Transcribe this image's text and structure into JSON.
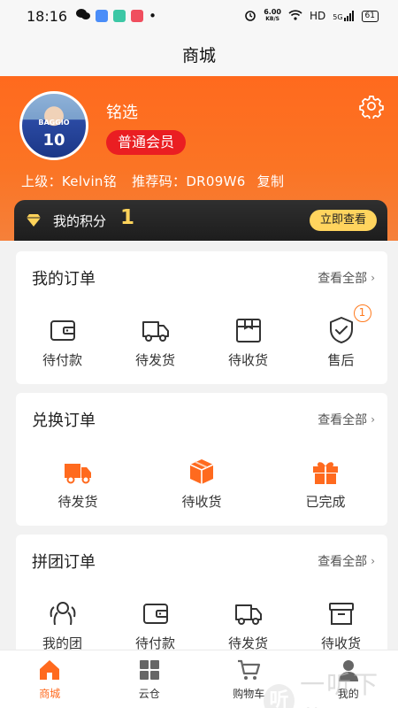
{
  "status_bar": {
    "time": "18:16",
    "dot": "•",
    "net_speed_value": "6.00",
    "net_speed_unit": "KB/S",
    "hd": "HD",
    "signal": "5G",
    "battery": "61"
  },
  "header": {
    "title": "商城"
  },
  "profile": {
    "name": "铭选",
    "member_level": "普通会员",
    "avatar_jersey_name": "BAGGIO",
    "avatar_jersey_number": "10",
    "referrer_label": "上级：",
    "referrer_name": "Kelvin铭",
    "ref_code_label": "推荐码：",
    "ref_code": "DR09W6",
    "copy_label": "复制"
  },
  "points": {
    "label": "我的积分",
    "value": "1",
    "button": "立即查看"
  },
  "my_orders": {
    "title": "我的订单",
    "view_all": "查看全部",
    "items": [
      {
        "label": "待付款",
        "icon": "wallet-icon"
      },
      {
        "label": "待发货",
        "icon": "truck-icon"
      },
      {
        "label": "待收货",
        "icon": "package-icon"
      },
      {
        "label": "售后",
        "icon": "shield-check-icon",
        "badge": "1"
      }
    ]
  },
  "exchange_orders": {
    "title": "兑换订单",
    "view_all": "查看全部",
    "items": [
      {
        "label": "待发货",
        "icon": "truck-filled-icon"
      },
      {
        "label": "待收货",
        "icon": "box-filled-icon"
      },
      {
        "label": "已完成",
        "icon": "gift-icon"
      }
    ]
  },
  "group_orders": {
    "title": "拼团订单",
    "view_all": "查看全部",
    "items": [
      {
        "label": "我的团",
        "icon": "group-icon"
      },
      {
        "label": "待付款",
        "icon": "wallet-icon"
      },
      {
        "label": "待发货",
        "icon": "truck-icon"
      },
      {
        "label": "待收货",
        "icon": "archive-box-icon"
      }
    ]
  },
  "bottom_nav": [
    {
      "label": "商城",
      "icon": "home-icon",
      "active": true
    },
    {
      "label": "云仓",
      "icon": "grid-icon"
    },
    {
      "label": "购物车",
      "icon": "cart-icon"
    },
    {
      "label": "我的",
      "icon": "user-icon"
    }
  ],
  "watermark": {
    "glyph": "听",
    "text": "一听下载"
  },
  "colors": {
    "accent": "#ff6a1e",
    "member_badge": "#ea1e22",
    "points_value": "#ffd35a",
    "points_button": "#ffd45e",
    "points_bar": "#262626"
  }
}
